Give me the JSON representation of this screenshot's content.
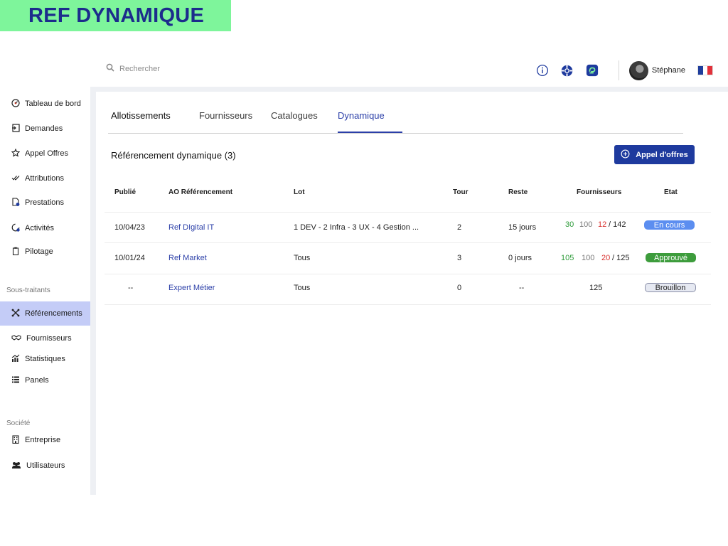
{
  "banner": {
    "title": "REF DYNAMIQUE"
  },
  "topbar": {
    "search_placeholder": "Rechercher",
    "user_name": "Stéphane",
    "icons": [
      "info-icon",
      "lifebuoy-icon",
      "app-logo-icon"
    ],
    "language_flag": "fr"
  },
  "sidebar": {
    "items": [
      {
        "label": "Tableau de bord",
        "icon": "dashboard-icon"
      },
      {
        "label": "Demandes",
        "icon": "request-icon"
      },
      {
        "label": "Appel Offres",
        "icon": "star-icon"
      },
      {
        "label": "Attributions",
        "icon": "check-double-icon"
      },
      {
        "label": "Prestations",
        "icon": "document-check-icon"
      },
      {
        "label": "Activités",
        "icon": "activity-icon"
      },
      {
        "label": "Pilotage",
        "icon": "clipboard-icon"
      }
    ],
    "section_subcontractors": "Sous-traitants",
    "sub_items": [
      {
        "label": "Référencements",
        "icon": "network-icon",
        "active": true
      },
      {
        "label": "Fournisseurs",
        "icon": "handshake-icon"
      },
      {
        "label": "Statistiques",
        "icon": "chart-icon"
      },
      {
        "label": "Panels",
        "icon": "list-icon"
      }
    ],
    "section_company": "Société",
    "company_items": [
      {
        "label": "Entreprise",
        "icon": "building-icon"
      },
      {
        "label": "Utilisateurs",
        "icon": "users-icon"
      }
    ]
  },
  "tabs": [
    {
      "label": "Allotissements"
    },
    {
      "label": "Fournisseurs"
    },
    {
      "label": "Catalogues"
    },
    {
      "label": "Dynamique",
      "active": true
    }
  ],
  "section": {
    "title": "Référencement dynamique (3)",
    "cta_label": "Appel d'offres"
  },
  "table": {
    "headers": [
      "Publié",
      "AO Référencement",
      "Lot",
      "Tour",
      "Reste",
      "Fournisseurs",
      "Etat"
    ],
    "rows": [
      {
        "published": "10/04/23",
        "ao": "Ref DIgital IT",
        "lot": "1 DEV - 2 Infra - 3 UX - 4 Gestion ...",
        "tour": "2",
        "reste": "15 jours",
        "f_green": "30",
        "f_grey": "100",
        "f_red": "12",
        "f_total": "/ 142",
        "status": "En cours",
        "status_color": "#5c8ef0"
      },
      {
        "published": "10/01/24",
        "ao": "Ref Market",
        "lot": "Tous",
        "tour": "3",
        "reste": "0 jours",
        "f_green": "105",
        "f_grey": "100",
        "f_red": "20",
        "f_total": "/ 125",
        "status": "Approuvé",
        "status_color": "#3d9c3c"
      },
      {
        "published": "--",
        "ao": "Expert Métier",
        "lot": "Tous",
        "tour": "0",
        "reste": "--",
        "f_total_only": "125",
        "status": "Brouillon",
        "status_color": "#e6e9f2"
      }
    ]
  }
}
